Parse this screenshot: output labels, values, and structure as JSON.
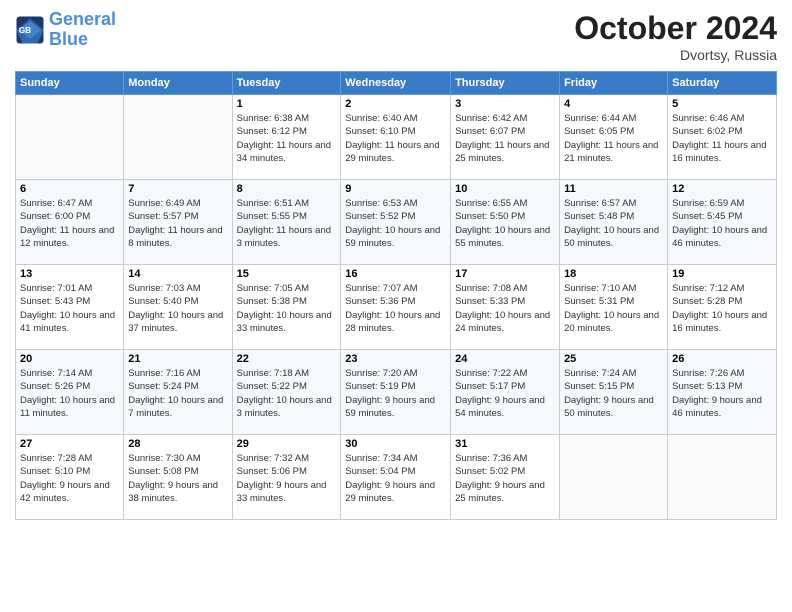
{
  "header": {
    "logo_line1": "General",
    "logo_line2": "Blue",
    "month": "October 2024",
    "location": "Dvortsy, Russia"
  },
  "weekdays": [
    "Sunday",
    "Monday",
    "Tuesday",
    "Wednesday",
    "Thursday",
    "Friday",
    "Saturday"
  ],
  "weeks": [
    [
      {
        "day": "",
        "info": ""
      },
      {
        "day": "",
        "info": ""
      },
      {
        "day": "1",
        "info": "Sunrise: 6:38 AM\nSunset: 6:12 PM\nDaylight: 11 hours and 34 minutes."
      },
      {
        "day": "2",
        "info": "Sunrise: 6:40 AM\nSunset: 6:10 PM\nDaylight: 11 hours and 29 minutes."
      },
      {
        "day": "3",
        "info": "Sunrise: 6:42 AM\nSunset: 6:07 PM\nDaylight: 11 hours and 25 minutes."
      },
      {
        "day": "4",
        "info": "Sunrise: 6:44 AM\nSunset: 6:05 PM\nDaylight: 11 hours and 21 minutes."
      },
      {
        "day": "5",
        "info": "Sunrise: 6:46 AM\nSunset: 6:02 PM\nDaylight: 11 hours and 16 minutes."
      }
    ],
    [
      {
        "day": "6",
        "info": "Sunrise: 6:47 AM\nSunset: 6:00 PM\nDaylight: 11 hours and 12 minutes."
      },
      {
        "day": "7",
        "info": "Sunrise: 6:49 AM\nSunset: 5:57 PM\nDaylight: 11 hours and 8 minutes."
      },
      {
        "day": "8",
        "info": "Sunrise: 6:51 AM\nSunset: 5:55 PM\nDaylight: 11 hours and 3 minutes."
      },
      {
        "day": "9",
        "info": "Sunrise: 6:53 AM\nSunset: 5:52 PM\nDaylight: 10 hours and 59 minutes."
      },
      {
        "day": "10",
        "info": "Sunrise: 6:55 AM\nSunset: 5:50 PM\nDaylight: 10 hours and 55 minutes."
      },
      {
        "day": "11",
        "info": "Sunrise: 6:57 AM\nSunset: 5:48 PM\nDaylight: 10 hours and 50 minutes."
      },
      {
        "day": "12",
        "info": "Sunrise: 6:59 AM\nSunset: 5:45 PM\nDaylight: 10 hours and 46 minutes."
      }
    ],
    [
      {
        "day": "13",
        "info": "Sunrise: 7:01 AM\nSunset: 5:43 PM\nDaylight: 10 hours and 41 minutes."
      },
      {
        "day": "14",
        "info": "Sunrise: 7:03 AM\nSunset: 5:40 PM\nDaylight: 10 hours and 37 minutes."
      },
      {
        "day": "15",
        "info": "Sunrise: 7:05 AM\nSunset: 5:38 PM\nDaylight: 10 hours and 33 minutes."
      },
      {
        "day": "16",
        "info": "Sunrise: 7:07 AM\nSunset: 5:36 PM\nDaylight: 10 hours and 28 minutes."
      },
      {
        "day": "17",
        "info": "Sunrise: 7:08 AM\nSunset: 5:33 PM\nDaylight: 10 hours and 24 minutes."
      },
      {
        "day": "18",
        "info": "Sunrise: 7:10 AM\nSunset: 5:31 PM\nDaylight: 10 hours and 20 minutes."
      },
      {
        "day": "19",
        "info": "Sunrise: 7:12 AM\nSunset: 5:28 PM\nDaylight: 10 hours and 16 minutes."
      }
    ],
    [
      {
        "day": "20",
        "info": "Sunrise: 7:14 AM\nSunset: 5:26 PM\nDaylight: 10 hours and 11 minutes."
      },
      {
        "day": "21",
        "info": "Sunrise: 7:16 AM\nSunset: 5:24 PM\nDaylight: 10 hours and 7 minutes."
      },
      {
        "day": "22",
        "info": "Sunrise: 7:18 AM\nSunset: 5:22 PM\nDaylight: 10 hours and 3 minutes."
      },
      {
        "day": "23",
        "info": "Sunrise: 7:20 AM\nSunset: 5:19 PM\nDaylight: 9 hours and 59 minutes."
      },
      {
        "day": "24",
        "info": "Sunrise: 7:22 AM\nSunset: 5:17 PM\nDaylight: 9 hours and 54 minutes."
      },
      {
        "day": "25",
        "info": "Sunrise: 7:24 AM\nSunset: 5:15 PM\nDaylight: 9 hours and 50 minutes."
      },
      {
        "day": "26",
        "info": "Sunrise: 7:26 AM\nSunset: 5:13 PM\nDaylight: 9 hours and 46 minutes."
      }
    ],
    [
      {
        "day": "27",
        "info": "Sunrise: 7:28 AM\nSunset: 5:10 PM\nDaylight: 9 hours and 42 minutes."
      },
      {
        "day": "28",
        "info": "Sunrise: 7:30 AM\nSunset: 5:08 PM\nDaylight: 9 hours and 38 minutes."
      },
      {
        "day": "29",
        "info": "Sunrise: 7:32 AM\nSunset: 5:06 PM\nDaylight: 9 hours and 33 minutes."
      },
      {
        "day": "30",
        "info": "Sunrise: 7:34 AM\nSunset: 5:04 PM\nDaylight: 9 hours and 29 minutes."
      },
      {
        "day": "31",
        "info": "Sunrise: 7:36 AM\nSunset: 5:02 PM\nDaylight: 9 hours and 25 minutes."
      },
      {
        "day": "",
        "info": ""
      },
      {
        "day": "",
        "info": ""
      }
    ]
  ]
}
